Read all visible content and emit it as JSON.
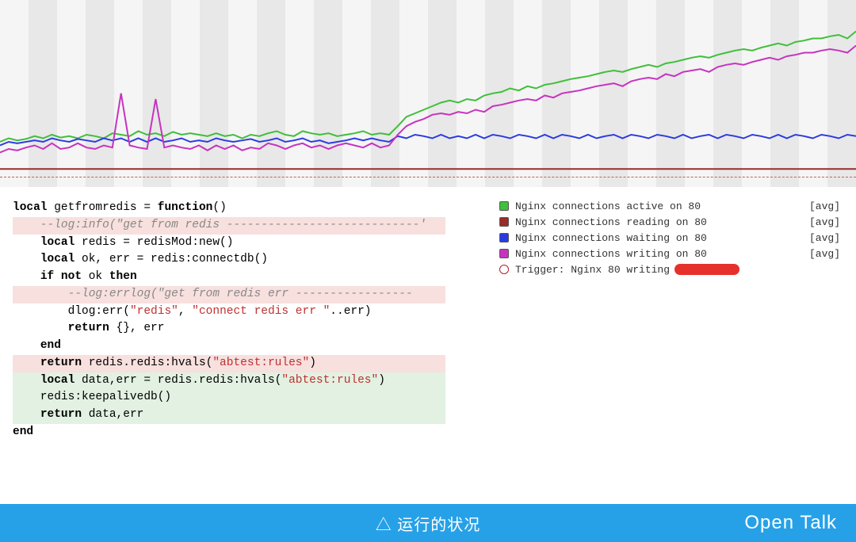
{
  "chart_data": {
    "type": "line",
    "xrange": [
      0,
      100
    ],
    "yrange": [
      0,
      240
    ],
    "series": [
      {
        "name": "Nginx connections active on 80",
        "color": "#3fbf3a",
        "agg": "[avg]",
        "points": [
          50,
          55,
          52,
          54,
          58,
          55,
          60,
          56,
          58,
          55,
          60,
          58,
          55,
          62,
          60,
          58,
          65,
          60,
          62,
          58,
          64,
          60,
          62,
          60,
          58,
          62,
          58,
          60,
          55,
          60,
          58,
          62,
          65,
          60,
          58,
          65,
          62,
          60,
          62,
          58,
          60,
          62,
          65,
          60,
          62,
          60,
          72,
          85,
          90,
          95,
          100,
          105,
          108,
          105,
          110,
          108,
          115,
          118,
          120,
          125,
          122,
          128,
          125,
          130,
          132,
          135,
          138,
          140,
          142,
          145,
          148,
          150,
          148,
          152,
          155,
          158,
          155,
          160,
          162,
          165,
          168,
          170,
          168,
          172,
          175,
          178,
          180,
          178,
          182,
          185,
          188,
          185,
          190,
          192,
          195,
          195,
          198,
          200,
          195,
          205
        ]
      },
      {
        "name": "Nginx connections reading on 80",
        "color": "#9a2c2c",
        "agg": "[avg]",
        "points": [
          12,
          12,
          12,
          12,
          12,
          12,
          12,
          12,
          12,
          12,
          12,
          12,
          12,
          12,
          12,
          12,
          12,
          12,
          12,
          12,
          12,
          12,
          12,
          12,
          12,
          12,
          12,
          12,
          12,
          12,
          12,
          12,
          12,
          12,
          12,
          12,
          12,
          12,
          12,
          12,
          12,
          12,
          12,
          12,
          12,
          12,
          12,
          12,
          12,
          12,
          12,
          12,
          12,
          12,
          12,
          12,
          12,
          12,
          12,
          12,
          12,
          12,
          12,
          12,
          12,
          12,
          12,
          12,
          12,
          12,
          12,
          12,
          12,
          12,
          12,
          12,
          12,
          12,
          12,
          12,
          12,
          12,
          12,
          12,
          12,
          12,
          12,
          12,
          12,
          12,
          12,
          12,
          12,
          12,
          12,
          12,
          12,
          12,
          12,
          12
        ]
      },
      {
        "name": "Nginx connections waiting on 80",
        "color": "#2b3be2",
        "agg": "[avg]",
        "points": [
          45,
          50,
          48,
          50,
          52,
          50,
          55,
          52,
          50,
          54,
          52,
          50,
          55,
          52,
          55,
          50,
          55,
          50,
          55,
          50,
          52,
          55,
          50,
          52,
          50,
          55,
          52,
          50,
          52,
          54,
          50,
          52,
          55,
          50,
          52,
          55,
          50,
          52,
          48,
          50,
          52,
          55,
          52,
          55,
          52,
          50,
          58,
          55,
          60,
          58,
          55,
          60,
          55,
          58,
          55,
          60,
          55,
          60,
          58,
          55,
          60,
          58,
          55,
          60,
          55,
          60,
          58,
          55,
          60,
          55,
          58,
          60,
          55,
          60,
          58,
          55,
          60,
          58,
          55,
          60,
          55,
          58,
          60,
          55,
          60,
          58,
          55,
          60,
          58,
          55,
          60,
          55,
          60,
          58,
          55,
          60,
          58,
          55,
          60,
          58
        ]
      },
      {
        "name": "Nginx connections writing on 80",
        "color": "#c733c0",
        "agg": "[avg]",
        "points": [
          35,
          40,
          38,
          42,
          45,
          40,
          48,
          40,
          42,
          48,
          42,
          40,
          45,
          42,
          118,
          45,
          42,
          40,
          110,
          42,
          45,
          42,
          40,
          45,
          38,
          45,
          40,
          45,
          38,
          42,
          40,
          48,
          45,
          40,
          45,
          48,
          42,
          45,
          40,
          45,
          48,
          45,
          42,
          48,
          42,
          45,
          60,
          72,
          78,
          82,
          88,
          90,
          88,
          92,
          90,
          95,
          92,
          100,
          102,
          105,
          108,
          110,
          108,
          115,
          112,
          118,
          120,
          122,
          125,
          128,
          130,
          132,
          128,
          135,
          138,
          140,
          138,
          145,
          142,
          148,
          150,
          152,
          148,
          155,
          158,
          160,
          158,
          162,
          165,
          168,
          165,
          170,
          172,
          175,
          175,
          178,
          180,
          178,
          175,
          185
        ]
      }
    ],
    "trigger": {
      "label": "Trigger: Nginx 80 writing"
    },
    "bands": 30
  },
  "code": {
    "lines": [
      {
        "cls": "",
        "segs": [
          [
            "kw",
            "local "
          ],
          [
            "",
            "getfromredis = "
          ],
          [
            "kw",
            "function"
          ],
          [
            "",
            "()"
          ]
        ]
      },
      {
        "cls": "red-bg",
        "segs": [
          [
            "cmt",
            "    --log:info(\"get from redis ----------------------------'"
          ]
        ]
      },
      {
        "cls": "",
        "segs": [
          [
            "",
            "    "
          ],
          [
            "kw",
            "local "
          ],
          [
            "",
            "redis = redisMod:new()"
          ]
        ]
      },
      {
        "cls": "",
        "segs": [
          [
            "",
            "    "
          ],
          [
            "kw",
            "local "
          ],
          [
            "",
            "ok, err = redis:connectdb()"
          ]
        ]
      },
      {
        "cls": "",
        "segs": [
          [
            "",
            "    "
          ],
          [
            "kw",
            "if not "
          ],
          [
            "",
            "ok "
          ],
          [
            "kw",
            "then"
          ]
        ]
      },
      {
        "cls": "red-bg",
        "segs": [
          [
            "cmt",
            "        --log:errlog(\"get from redis err -----------------"
          ]
        ]
      },
      {
        "cls": "",
        "segs": [
          [
            "",
            "        dlog:err("
          ],
          [
            "str",
            "\"redis\""
          ],
          [
            "",
            ", "
          ],
          [
            "str",
            "\"connect redis err \""
          ],
          [
            "",
            "..err)"
          ]
        ]
      },
      {
        "cls": "",
        "segs": [
          [
            "",
            "        "
          ],
          [
            "kw",
            "return"
          ],
          [
            "",
            " {}, err"
          ]
        ]
      },
      {
        "cls": "",
        "segs": [
          [
            "",
            "    "
          ],
          [
            "kw",
            "end"
          ]
        ]
      },
      {
        "cls": "red-bg",
        "segs": [
          [
            "",
            "    "
          ],
          [
            "kw",
            "return"
          ],
          [
            "",
            " redis.redis:hvals("
          ],
          [
            "str",
            "\"abtest:rules\""
          ],
          [
            "",
            ")"
          ]
        ]
      },
      {
        "cls": "green-bg",
        "segs": [
          [
            "",
            "    "
          ],
          [
            "kw",
            "local "
          ],
          [
            "",
            "data,err = redis.redis:hvals("
          ],
          [
            "str",
            "\"abtest:rules\""
          ],
          [
            "",
            ")"
          ]
        ]
      },
      {
        "cls": "green-bg",
        "segs": [
          [
            "",
            "    redis:keepalivedb()"
          ]
        ]
      },
      {
        "cls": "green-bg",
        "segs": [
          [
            "",
            "    "
          ],
          [
            "kw",
            "return"
          ],
          [
            "",
            " data,err"
          ]
        ]
      },
      {
        "cls": "",
        "segs": [
          [
            "kw",
            "end"
          ]
        ]
      }
    ]
  },
  "footer": {
    "caption": "△ 运行的状况",
    "brand": "Open Talk"
  }
}
